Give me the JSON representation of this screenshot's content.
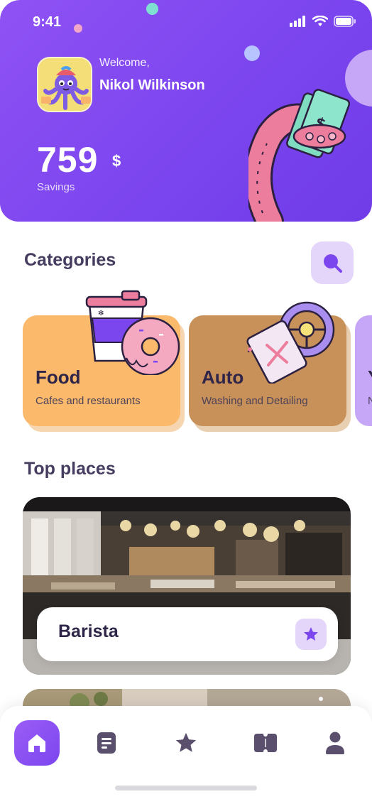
{
  "status_bar": {
    "time": "9:41"
  },
  "header": {
    "welcome": "Welcome,",
    "user_name": "Nikol Wilkinson",
    "savings_amount": "759",
    "savings_currency": "$",
    "savings_label": "Savings"
  },
  "categories": {
    "title": "Categories",
    "items": [
      {
        "title": "Food",
        "subtitle": "Cafes and restaurants",
        "color": "#fbb96c"
      },
      {
        "title": "Auto",
        "subtitle": "Washing and Detailing",
        "color": "#c8915a"
      },
      {
        "title": "Y",
        "subtitle": "N",
        "color": "#c6a6f6"
      }
    ]
  },
  "top_places": {
    "title": "Top places",
    "items": [
      {
        "name": "Barista"
      }
    ]
  },
  "nav": {
    "items": [
      {
        "icon": "home-icon",
        "active": true
      },
      {
        "icon": "list-icon",
        "active": false
      },
      {
        "icon": "star-icon",
        "active": false
      },
      {
        "icon": "ticket-icon",
        "active": false
      },
      {
        "icon": "profile-icon",
        "active": false
      }
    ]
  },
  "colors": {
    "accent": "#7c46ee",
    "accent_light": "#e4d6fb",
    "text_dark": "#2e2548"
  }
}
